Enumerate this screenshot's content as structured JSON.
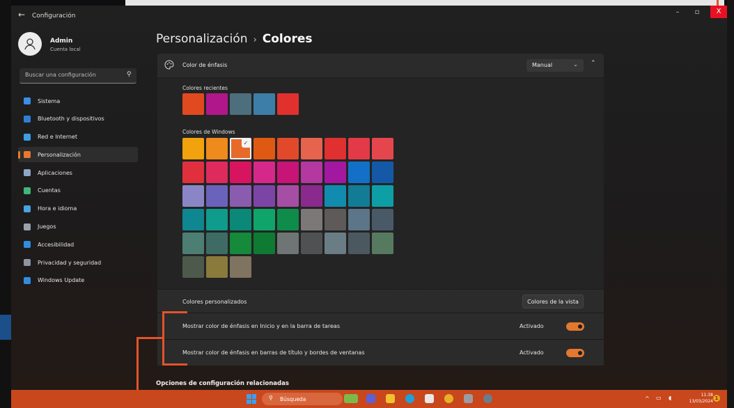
{
  "window": {
    "app_title": "Configuración",
    "back_glyph": "←",
    "min_glyph": "–",
    "max_glyph": "▫",
    "close_glyph": "X"
  },
  "user": {
    "name": "Admin",
    "subtitle": "Cuenta local"
  },
  "search": {
    "placeholder": "Buscar una configuración"
  },
  "sidebar": {
    "items": [
      {
        "label": "Sistema",
        "icon": "monitor-icon",
        "color": "#3a8ee6",
        "active": false
      },
      {
        "label": "Bluetooth y dispositivos",
        "icon": "bluetooth-icon",
        "color": "#2f7fd8",
        "active": false
      },
      {
        "label": "Red e Internet",
        "icon": "wifi-icon",
        "color": "#3b9fe8",
        "active": false
      },
      {
        "label": "Personalización",
        "icon": "brush-icon",
        "color": "#e8782f",
        "active": true
      },
      {
        "label": "Aplicaciones",
        "icon": "apps-icon",
        "color": "#8ea6c8",
        "active": false
      },
      {
        "label": "Cuentas",
        "icon": "person-icon",
        "color": "#3fb67a",
        "active": false
      },
      {
        "label": "Hora e idioma",
        "icon": "globe-clock-icon",
        "color": "#4aa3e0",
        "active": false
      },
      {
        "label": "Juegos",
        "icon": "gamepad-icon",
        "color": "#9aa3ad",
        "active": false
      },
      {
        "label": "Accesibilidad",
        "icon": "accessibility-icon",
        "color": "#2f8ee0",
        "active": false
      },
      {
        "label": "Privacidad y seguridad",
        "icon": "shield-icon",
        "color": "#8c96a0",
        "active": false
      },
      {
        "label": "Windows Update",
        "icon": "update-icon",
        "color": "#2f8ee0",
        "active": false
      }
    ]
  },
  "breadcrumb": {
    "parent": "Personalización",
    "separator": "›",
    "current": "Colores"
  },
  "accent": {
    "label": "Color de énfasis",
    "mode": "Manual",
    "recent_label": "Colores recientes",
    "recent_colors": [
      "#e04a1e",
      "#b0178a",
      "#4d6f7d",
      "#3d7ea8",
      "#e0312e"
    ],
    "windows_label": "Colores de Windows",
    "selected_index": 2,
    "windows_colors": [
      "#f2a20c",
      "#ef8a1c",
      "#e86a2a",
      "#e05912",
      "#e2492a",
      "#e6634e",
      "#e0302f",
      "#e23a46",
      "#e5464e",
      "#e0303e",
      "#de2a5c",
      "#d81460",
      "#d6288a",
      "#c81477",
      "#b338a0",
      "#a318a0",
      "#1270c8",
      "#1459a8",
      "#8a86c6",
      "#6b62bc",
      "#8a5cb0",
      "#7b45a6",
      "#a54ea4",
      "#8a2a8c",
      "#118cae",
      "#127c96",
      "#0e9ea6",
      "#0e8790",
      "#0f9c8c",
      "#0c8878",
      "#0fa46a",
      "#0f8c4a",
      "#7d7878",
      "#5d5a59",
      "#5d7588",
      "#4a5968",
      "#4d7e74",
      "#3e6c65",
      "#148a3a",
      "#0f7a32",
      "#6f7474",
      "#4f5252",
      "#6a7d84",
      "#4b5860",
      "#557a60",
      "#4d5a4b",
      "#8a7a3c",
      "#7f7460"
    ]
  },
  "custom_colors": {
    "label": "Colores personalizados",
    "button": "Colores de la vista"
  },
  "toggles": [
    {
      "label": "Mostrar color de énfasis en Inicio y en la barra de tareas",
      "state": "Activado"
    },
    {
      "label": "Mostrar color de énfasis en barras de título y bordes de ventanas",
      "state": "Activado"
    }
  ],
  "related": {
    "label": "Opciones de configuración relacionadas"
  },
  "taskbar": {
    "search_label": "Búsqueda",
    "time": "11:38",
    "date": "13/03/2024",
    "badge": "1",
    "tray_up": "^"
  }
}
